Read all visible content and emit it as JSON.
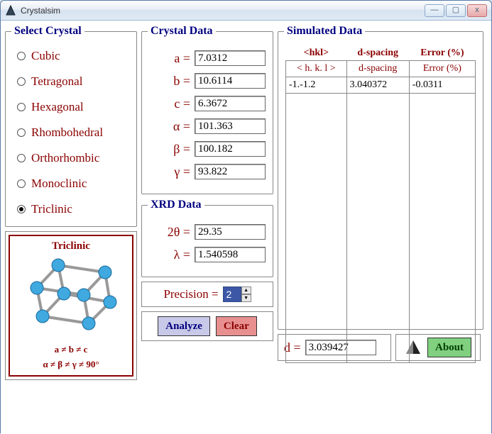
{
  "window": {
    "title": "Crystalsim",
    "min": "—",
    "max": "▢",
    "close": "x"
  },
  "select_crystal": {
    "legend": "Select Crystal",
    "items": [
      {
        "label": "Cubic",
        "selected": false
      },
      {
        "label": "Tetragonal",
        "selected": false
      },
      {
        "label": "Hexagonal",
        "selected": false
      },
      {
        "label": "Rhombohedral",
        "selected": false
      },
      {
        "label": "Orthorhombic",
        "selected": false
      },
      {
        "label": "Monoclinic",
        "selected": false
      },
      {
        "label": "Triclinic",
        "selected": true
      }
    ]
  },
  "preview": {
    "title": "Triclinic",
    "line1": "a ≠ b ≠ c",
    "line2": "α ≠ β ≠ γ ≠ 90°"
  },
  "crystal_data": {
    "legend": "Crystal Data",
    "a_label": "a  =",
    "a": "7.0312",
    "b_label": "b  =",
    "b": "10.6114",
    "c_label": "c  =",
    "c": "6.3672",
    "alpha_label": "α  =",
    "alpha": "101.363",
    "beta_label": "β  =",
    "beta": "100.182",
    "gamma_label": "γ  =",
    "gamma": "93.822"
  },
  "xrd_data": {
    "legend": "XRD Data",
    "twotheta_label": "2θ  =",
    "twotheta": "29.35",
    "lambda_label": "λ  =",
    "lambda": "1.540598"
  },
  "precision": {
    "label": "Precision  =",
    "value": "2"
  },
  "buttons": {
    "analyze": "Analyze",
    "clear": "Clear",
    "about": "About"
  },
  "simulated": {
    "legend": "Simulated Data",
    "header": {
      "hkl": "<hkl>",
      "dspacing": "d-spacing",
      "error": "Error (%)"
    },
    "header2": {
      "hkl": "< h. k. l >",
      "dspacing": "d-spacing",
      "error": "Error (%)"
    },
    "rows": [
      {
        "hkl": "-1.-1.2",
        "dspacing": "3.040372",
        "error": "-0.0311"
      }
    ]
  },
  "d_result": {
    "label": "d  =",
    "value": "3.039427"
  }
}
